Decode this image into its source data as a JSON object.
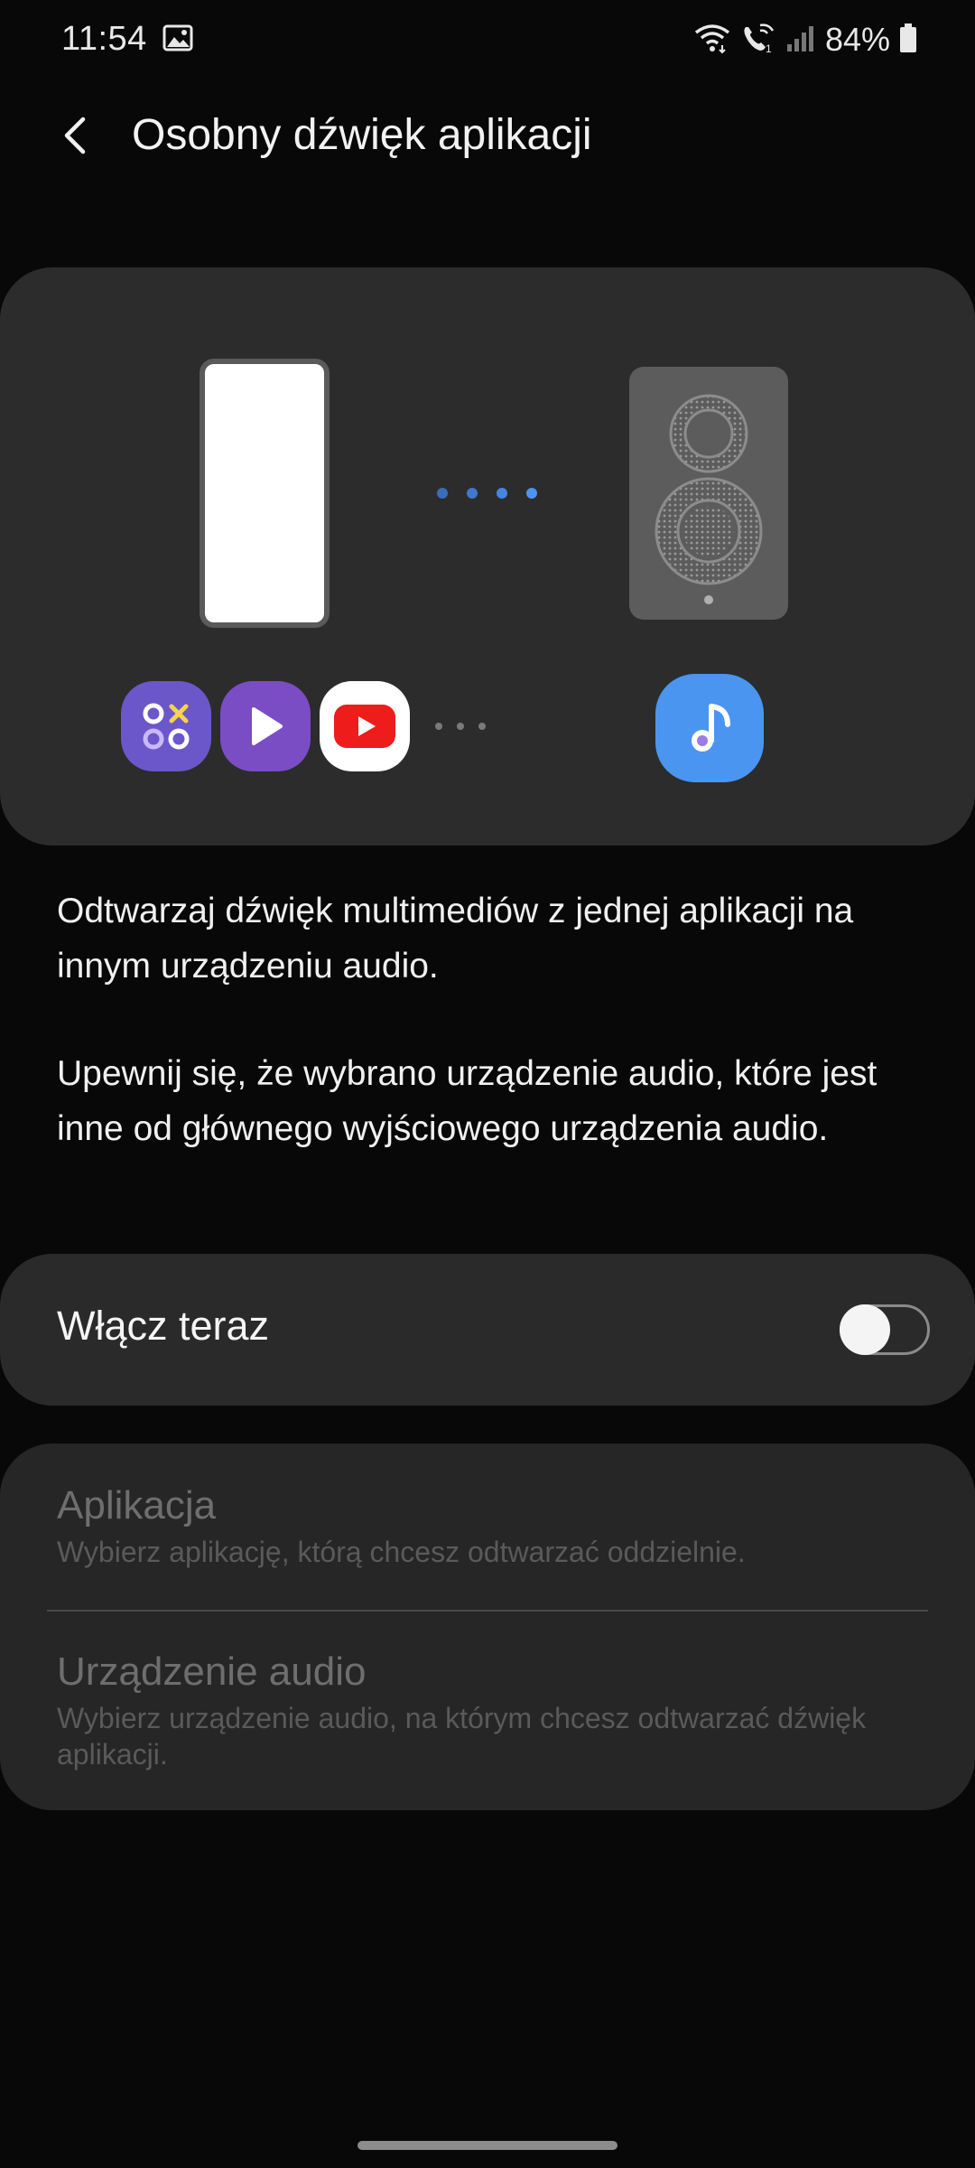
{
  "status_bar": {
    "time": "11:54",
    "battery": "84%",
    "icons": [
      "gallery-icon",
      "wifi-icon",
      "wifi-calling-icon",
      "signal-icon",
      "battery-icon"
    ]
  },
  "header": {
    "title": "Osobny dźwięk aplikacji",
    "back_icon": "chevron-left-icon"
  },
  "illustration": {
    "icons": [
      "phone-illustration",
      "connection-dots",
      "speaker-illustration",
      "game-launcher-app-icon",
      "video-player-app-icon",
      "youtube-app-icon",
      "more-dots-icon",
      "music-app-icon"
    ]
  },
  "description": {
    "paragraph1": "Odtwarzaj dźwięk multimediów z jednej aplikacji na innym urządzeniu audio.",
    "paragraph2": "Upewnij się, że wybrano urządzenie audio, które jest inne od głównego wyjściowego urządzenia audio."
  },
  "toggle": {
    "label": "Włącz teraz",
    "enabled": false
  },
  "settings": {
    "app": {
      "title": "Aplikacja",
      "subtitle": "Wybierz aplikację, którą chcesz odtwarzać oddzielnie."
    },
    "audio_device": {
      "title": "Urządzenie audio",
      "subtitle": "Wybierz urządzenie audio, na którym chcesz odtwarzać dźwięk aplikacji."
    }
  },
  "colors": {
    "background": "#080808",
    "card": "#2c2c2c",
    "accent_blue": "#4a95ef",
    "disabled_text": "#6e6e6e"
  }
}
